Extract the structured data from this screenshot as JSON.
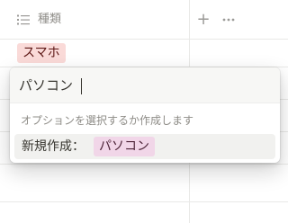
{
  "column": {
    "icon": "list-icon",
    "title": "種類",
    "add_label": "+",
    "more_icon": "more-horizontal-icon"
  },
  "cell": {
    "tag_label": "スマホ",
    "tag_color": "#fadad8"
  },
  "popup": {
    "input_value": "パソコン",
    "hint": "オプションを選択するか作成します",
    "create_label": "新規作成：",
    "create_tag_label": "パソコン",
    "create_tag_color": "#f1d6e8"
  }
}
